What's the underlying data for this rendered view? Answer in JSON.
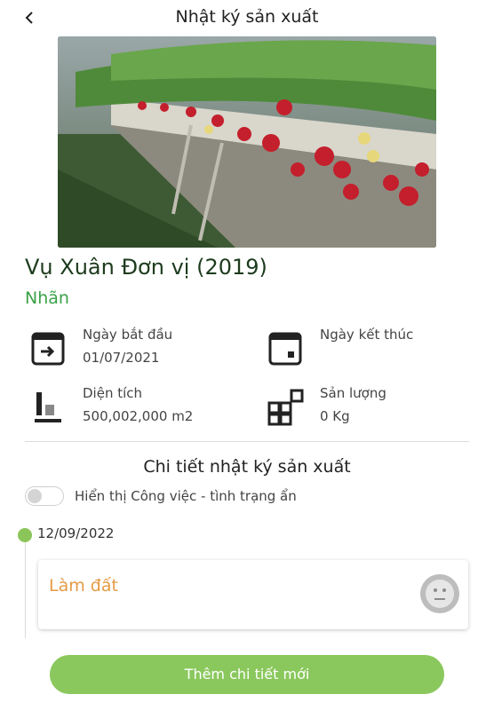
{
  "header": {
    "title": "Nhật ký sản xuất"
  },
  "season": {
    "name": "Vụ Xuân Đơn vị (2019)",
    "crop": "Nhãn"
  },
  "info": {
    "start_label": "Ngày bắt đầu",
    "start_value": "01/07/2021",
    "end_label": "Ngày kết thúc",
    "end_value": "",
    "area_label": "Diện tích",
    "area_value": "500,002,000 m2",
    "yield_label": "Sản lượng",
    "yield_value": "0 Kg"
  },
  "details": {
    "title": "Chi tiết nhật ký sản xuất",
    "toggle_label": "Hiển thị Công việc - tình trạng ẩn",
    "toggle_on": false
  },
  "timeline": [
    {
      "date": "12/09/2022",
      "task": "Làm đất",
      "status_icon": "neutral-face-icon"
    }
  ],
  "actions": {
    "add_label": "Thêm chi tiết mới"
  },
  "colors": {
    "accent": "#8ac85d",
    "crop_text": "#3aa248",
    "task_text": "#e59a45",
    "title_text": "#1d3b1d"
  }
}
